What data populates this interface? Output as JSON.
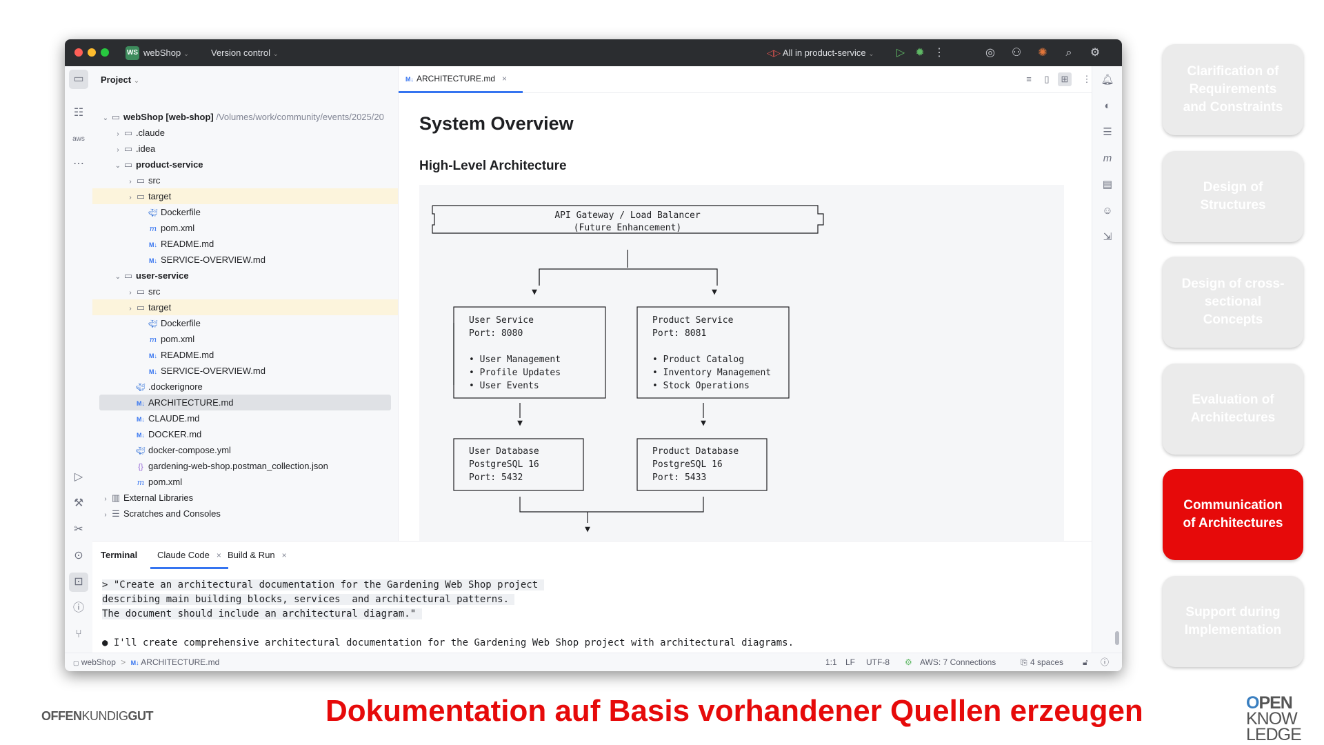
{
  "ide": {
    "project_name": "webShop",
    "project_badge": "WS",
    "vcs_label": "Version control",
    "run_config": "All in product-service",
    "project_panel_title": "Project",
    "tree": [
      {
        "label": "webShop [web-shop]",
        "path": " /Volumes/work/community/events/2025/20",
        "depth": 0,
        "chev": "v",
        "icon": "module"
      },
      {
        "label": ".claude",
        "depth": 1,
        "chev": ">",
        "icon": "folder"
      },
      {
        "label": ".idea",
        "depth": 1,
        "chev": ">",
        "icon": "folder"
      },
      {
        "label": "product-service",
        "depth": 1,
        "chev": "v",
        "icon": "module"
      },
      {
        "label": "src",
        "depth": 2,
        "chev": ">",
        "icon": "folder"
      },
      {
        "label": "target",
        "depth": 2,
        "chev": ">",
        "icon": "folder"
      },
      {
        "label": "Dockerfile",
        "depth": 3,
        "icon": "docker"
      },
      {
        "label": "pom.xml",
        "depth": 3,
        "icon": "pom"
      },
      {
        "label": "README.md",
        "depth": 3,
        "icon": "md"
      },
      {
        "label": "SERVICE-OVERVIEW.md",
        "depth": 3,
        "icon": "md"
      },
      {
        "label": "user-service",
        "depth": 1,
        "chev": "v",
        "icon": "module"
      },
      {
        "label": "src",
        "depth": 2,
        "chev": ">",
        "icon": "folder"
      },
      {
        "label": "target",
        "depth": 2,
        "chev": ">",
        "icon": "folder"
      },
      {
        "label": "Dockerfile",
        "depth": 3,
        "icon": "docker"
      },
      {
        "label": "pom.xml",
        "depth": 3,
        "icon": "pom"
      },
      {
        "label": "README.md",
        "depth": 3,
        "icon": "md"
      },
      {
        "label": "SERVICE-OVERVIEW.md",
        "depth": 3,
        "icon": "md"
      },
      {
        "label": ".dockerignore",
        "depth": 2,
        "icon": "docker"
      },
      {
        "label": "ARCHITECTURE.md",
        "depth": 2,
        "icon": "md"
      },
      {
        "label": "CLAUDE.md",
        "depth": 2,
        "icon": "md"
      },
      {
        "label": "DOCKER.md",
        "depth": 2,
        "icon": "md"
      },
      {
        "label": "docker-compose.yml",
        "depth": 2,
        "icon": "docker"
      },
      {
        "label": "gardening-web-shop.postman_collection.json",
        "depth": 2,
        "icon": "json"
      },
      {
        "label": "pom.xml",
        "depth": 2,
        "icon": "pom"
      },
      {
        "label": "External Libraries",
        "depth": 0,
        "chev": ">",
        "icon": "lib"
      },
      {
        "label": "Scratches and Consoles",
        "depth": 0,
        "chev": ">",
        "icon": "scratch"
      }
    ],
    "editor_tab": "ARCHITECTURE.md",
    "md_badge": "M↓",
    "doc_title": "System Overview",
    "doc_subtitle": "High-Level Architecture",
    "diagram": {
      "gateway_line1": "API Gateway / Load Balancer",
      "gateway_line2": "(Future Enhancement)",
      "user_service": [
        "User Service",
        "Port: 8080",
        "",
        "• User Management",
        "• Profile Updates",
        "• User Events"
      ],
      "product_service": [
        "Product Service",
        "Port: 8081",
        "",
        "• Product Catalog",
        "• Inventory Management",
        "• Stock Operations"
      ],
      "user_db": [
        "User Database",
        "PostgreSQL 16",
        "Port: 5432"
      ],
      "product_db": [
        "Product Database",
        "PostgreSQL 16",
        "Port: 5433"
      ],
      "arrow": "▼"
    },
    "terminal_tabs": [
      "Terminal",
      "Claude Code",
      "Build & Run"
    ],
    "terminal_lines": [
      "> \"Create an architectural documentation for the Gardening Web Shop project ",
      "describing main building blocks, services  and architectural patterns. ",
      "The document should include an architectural diagram.\" "
    ],
    "terminal_response": "● I'll create comprehensive architectural documentation for the Gardening Web Shop project with architectural diagrams.",
    "status": {
      "crumb_project": "webShop",
      "crumb_file": "ARCHITECTURE.md",
      "crumb_sep": ">",
      "position": "1:1",
      "line_sep": "LF",
      "encoding": "UTF-8",
      "aws": "AWS: 7 Connections",
      "indent": "4 spaces"
    }
  },
  "slide": {
    "phases": [
      {
        "label": "Clarification of Requirements and Constraints",
        "active": false
      },
      {
        "label": "Design of Structures",
        "active": false
      },
      {
        "label": "Design of cross-sectional Concepts",
        "active": false
      },
      {
        "label": "Evaluation of Architectures",
        "active": false
      },
      {
        "label": "Communication of Architectures",
        "active": true
      },
      {
        "label": "Support during Implementation",
        "active": false
      }
    ],
    "headline": "Dokumentation auf Basis vorhandener Quellen erzeugen",
    "footer_left_a": "OFFEN",
    "footer_left_b": "KUNDIG",
    "footer_left_c": "GUT",
    "logo_lines": [
      "OPEN",
      "KNOW",
      "LEDGE"
    ]
  }
}
